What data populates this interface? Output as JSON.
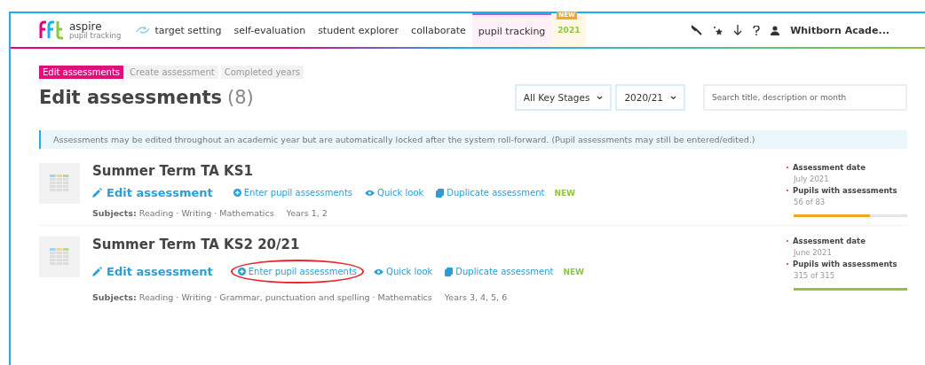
{
  "header": {
    "logo": "aspire",
    "logo_sub": "pupil tracking",
    "nav": [
      {
        "label": "target setting",
        "selected": false,
        "icon": true
      },
      {
        "label": "self-evaluation",
        "selected": false
      },
      {
        "label": "student explorer",
        "selected": false
      },
      {
        "label": "collaborate",
        "selected": false
      },
      {
        "label": "pupil tracking",
        "selected": true
      },
      {
        "label": "2021",
        "selected": false,
        "badge": "NEW"
      }
    ],
    "user": "Whitborn Acade..."
  },
  "tabs": [
    {
      "label": "Edit assessments",
      "selected": true
    },
    {
      "label": "Create assessment",
      "selected": false
    },
    {
      "label": "Completed years",
      "selected": false
    }
  ],
  "title": "Edit assessments",
  "count": "(8)",
  "filters": [
    {
      "value": "All Key Stages"
    },
    {
      "value": "2020/21"
    }
  ],
  "search": {
    "placeholder": "Search title, description or month"
  },
  "info": "Assessments may be edited throughout an academic year but are automatically locked after the system roll-forward. (Pupil assessments may still be entered/edited.)",
  "assessments": [
    {
      "title": "Summer Term TA KS1",
      "edit": "Edit assessment",
      "actions": [
        {
          "kind": "enter",
          "label": "Enter pupil assessments",
          "highlighted": false
        },
        {
          "kind": "look",
          "label": "Quick look",
          "highlighted": false
        },
        {
          "kind": "duplicate",
          "label": "Duplicate assessment",
          "highlighted": false,
          "badge": "NEW"
        }
      ],
      "subjects_label": "Subjects:",
      "subjects": "Reading · Writing · Mathematics",
      "years": "Years 1, 2",
      "date_label": "Assessment date",
      "date": "July 2021",
      "pupils_label": "Pupils with assessments",
      "pupils": "56 of 83",
      "level": 0.67,
      "color": "#f5a623"
    },
    {
      "title": "Summer Term TA KS2 20/21",
      "edit": "Edit assessment",
      "actions": [
        {
          "kind": "enter",
          "label": "Enter pupil assessments",
          "highlighted": true
        },
        {
          "kind": "look",
          "label": "Quick look",
          "highlighted": false
        },
        {
          "kind": "duplicate",
          "label": "Duplicate assessment",
          "highlighted": false,
          "badge": "NEW"
        }
      ],
      "subjects_label": "Subjects:",
      "subjects": "Reading · Writing · Grammar, punctuation and spelling · Mathematics",
      "years": "Years 3, 4, 5, 6",
      "date_label": "Assessment date",
      "date": "June 2021",
      "pupils_label": "Pupils with assessments",
      "pupils": "315 of 315",
      "level": 1,
      "color": "#8dc63f"
    }
  ]
}
